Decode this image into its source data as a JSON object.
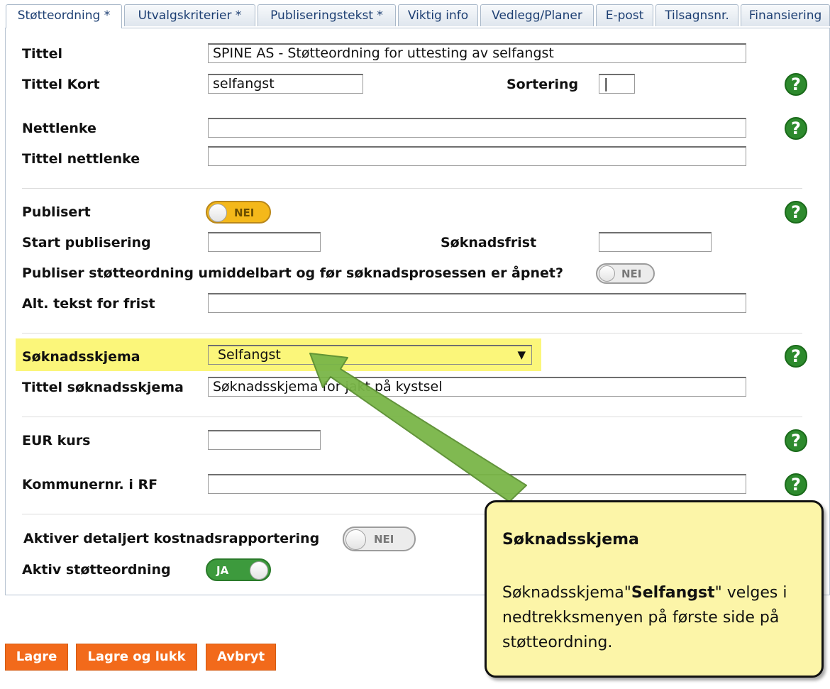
{
  "tabs": [
    {
      "label": "Støtteordning *",
      "active": true
    },
    {
      "label": "Utvalgskriterier *"
    },
    {
      "label": "Publiseringstekst *"
    },
    {
      "label": "Viktig info"
    },
    {
      "label": "Vedlegg/Planer"
    },
    {
      "label": "E-post"
    },
    {
      "label": "Tilsagnsnr."
    },
    {
      "label": "Finansiering"
    }
  ],
  "form": {
    "tittel_label": "Tittel",
    "tittel_value": "SPINE AS - Støtteordning for uttesting av selfangst",
    "tittel_kort_label": "Tittel Kort",
    "tittel_kort_value": "selfangst",
    "sortering_label": "Sortering",
    "sortering_value": "|",
    "nettlenke_label": "Nettlenke",
    "tittel_nettlenke_label": "Tittel nettlenke",
    "publisert_label": "Publisert",
    "publisert_toggle": "NEI",
    "start_publisering_label": "Start publisering",
    "soknadsfrist_label": "Søknadsfrist",
    "publiser_umiddelbart_label": "Publiser støtteordning umiddelbart og før søknadsprosessen er åpnet?",
    "publiser_umiddelbart_toggle": "NEI",
    "alt_tekst_label": "Alt. tekst for frist",
    "soknadsskjema_label": "Søknadsskjema",
    "soknadsskjema_value": "Selfangst",
    "tittel_soknadsskjema_label": "Tittel søknadsskjema",
    "tittel_soknadsskjema_value": "Søknadsskjema for jakt på kystsel",
    "eur_kurs_label": "EUR kurs",
    "kommunenr_label": "Kommunernr. i RF",
    "kostnadsrapportering_label": "Aktiver detaljert kostnadsrapportering",
    "kostnadsrapportering_toggle": "NEI",
    "aktiv_label": "Aktiv støtteordning",
    "aktiv_toggle": "JA"
  },
  "help_glyph": "?",
  "select_arrow": "▼",
  "buttons": {
    "lagre": "Lagre",
    "lagre_lukk": "Lagre og lukk",
    "avbryt": "Avbryt"
  },
  "callout": {
    "title": "Søknadsskjema",
    "body_pre": "Søknadsskjema\"",
    "body_bold": "Selfangst",
    "body_post": "\" velges i nedtrekksmenyen på første side på støtteordning."
  },
  "colors": {
    "accent_orange": "#f26a1b",
    "highlight_yellow": "#fbf67a",
    "callout_bg": "#fcf5a8",
    "arrow_green": "#7ab648",
    "help_green": "#2d8a2d"
  }
}
